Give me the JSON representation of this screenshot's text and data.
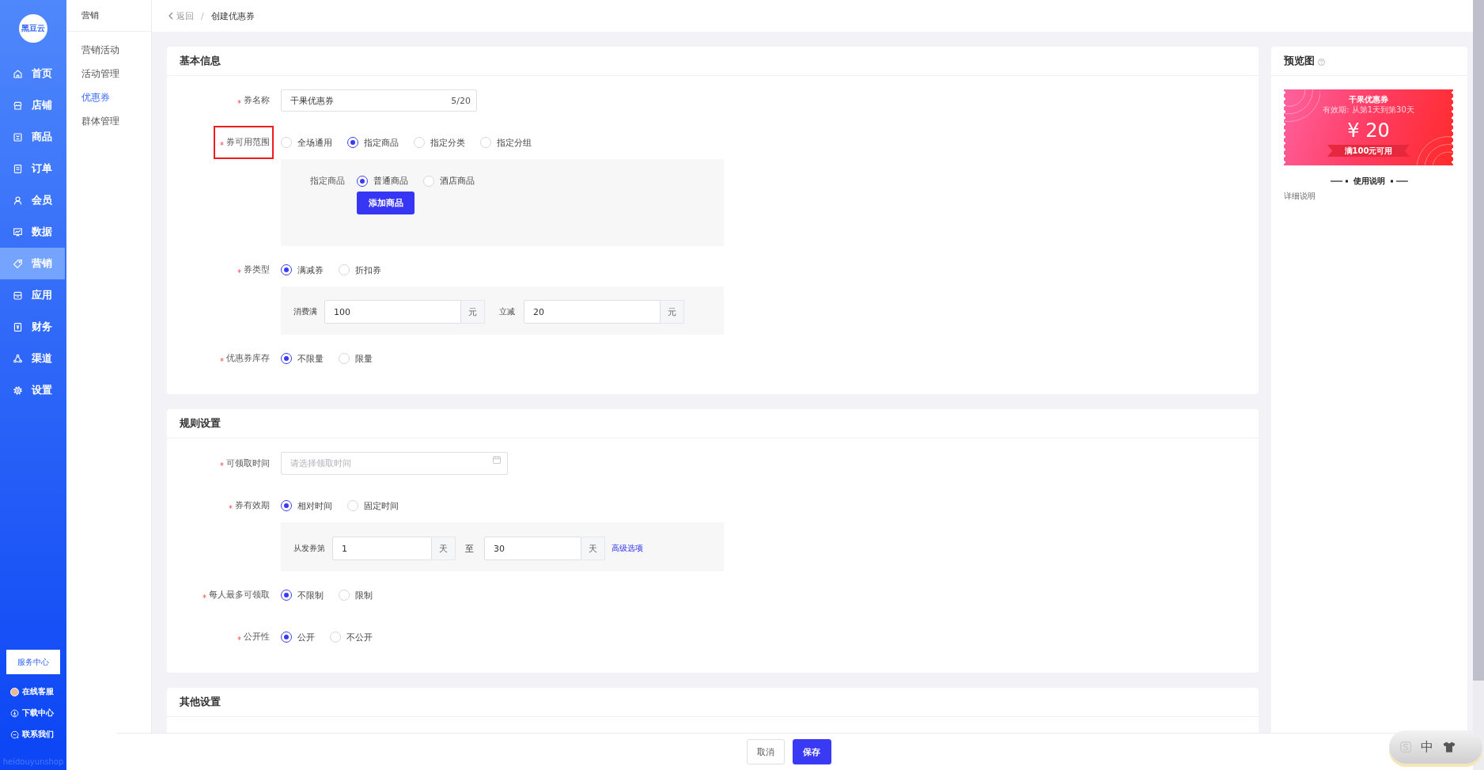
{
  "sidebar": {
    "logo": "黑豆云",
    "items": [
      {
        "label": "首页",
        "selected": false
      },
      {
        "label": "店铺",
        "selected": false
      },
      {
        "label": "商品",
        "selected": false
      },
      {
        "label": "订单",
        "selected": false
      },
      {
        "label": "会员",
        "selected": false
      },
      {
        "label": "数据",
        "selected": false
      },
      {
        "label": "营销",
        "selected": true
      },
      {
        "label": "应用",
        "selected": false
      },
      {
        "label": "财务",
        "selected": false
      },
      {
        "label": "渠道",
        "selected": false
      },
      {
        "label": "设置",
        "selected": false
      }
    ],
    "service_button": "服务中心",
    "links": [
      {
        "label": "在线客服"
      },
      {
        "label": "下载中心"
      },
      {
        "label": "联系我们"
      }
    ],
    "brand_text": "heidouyunshop"
  },
  "submenu": {
    "title": "营销",
    "items": [
      {
        "label": "营销活动",
        "selected": false
      },
      {
        "label": "活动管理",
        "selected": false
      },
      {
        "label": "优惠券",
        "selected": true
      },
      {
        "label": "群体管理",
        "selected": false
      }
    ]
  },
  "breadcrumb": {
    "back": "返回",
    "separator": "/",
    "current": "创建优惠券"
  },
  "sections": [
    {
      "title": "基本信息",
      "fields": [
        {
          "kind": "text",
          "label": "券名称",
          "required": true,
          "highlighted": false,
          "value": "干果优惠券",
          "counter": "5/20"
        },
        {
          "kind": "radio",
          "label": "券可用范围",
          "required": true,
          "highlighted": true,
          "options": [
            {
              "label": "全场通用",
              "selected": false
            },
            {
              "label": "指定商品",
              "selected": true
            },
            {
              "label": "指定分类",
              "selected": false
            },
            {
              "label": "指定分组",
              "selected": false
            }
          ],
          "panel": {
            "kind": "goods",
            "label": "指定商品",
            "options": [
              {
                "label": "普通商品",
                "selected": true
              },
              {
                "label": "酒店商品",
                "selected": false
              }
            ],
            "button": "添加商品"
          }
        },
        {
          "kind": "radio",
          "label": "券类型",
          "required": true,
          "highlighted": false,
          "options": [
            {
              "label": "满减券",
              "selected": true
            },
            {
              "label": "折扣券",
              "selected": false
            }
          ],
          "panel": {
            "kind": "amounts",
            "inputs": [
              {
                "label": "消费满",
                "value": "100",
                "unit": "元"
              },
              {
                "label": "立减",
                "value": "20",
                "unit": "元"
              }
            ]
          }
        },
        {
          "kind": "radio",
          "label": "优惠券库存",
          "required": true,
          "highlighted": false,
          "options": [
            {
              "label": "不限量",
              "selected": true
            },
            {
              "label": "限量",
              "selected": false
            }
          ]
        }
      ]
    },
    {
      "title": "规则设置",
      "fields": [
        {
          "kind": "date",
          "label": "可领取时间",
          "required": true,
          "highlighted": false,
          "placeholder": "请选择领取时间"
        },
        {
          "kind": "radio",
          "label": "券有效期",
          "required": true,
          "highlighted": false,
          "options": [
            {
              "label": "相对时间",
              "selected": true
            },
            {
              "label": "固定时间",
              "selected": false
            }
          ],
          "panel": {
            "kind": "range",
            "label": "从发券第",
            "from": {
              "value": "1",
              "unit": "天"
            },
            "separator": "至",
            "to": {
              "value": "30",
              "unit": "天"
            },
            "link": "高级选项"
          }
        },
        {
          "kind": "radio",
          "label": "每人最多可领取",
          "required": true,
          "highlighted": false,
          "options": [
            {
              "label": "不限制",
              "selected": true
            },
            {
              "label": "限制",
              "selected": false
            }
          ]
        },
        {
          "kind": "radio",
          "label": "公开性",
          "required": true,
          "highlighted": false,
          "options": [
            {
              "label": "公开",
              "selected": true
            },
            {
              "label": "不公开",
              "selected": false
            }
          ]
        }
      ]
    },
    {
      "title": "其他设置"
    }
  ],
  "preview": {
    "title": "预览图",
    "coupon": {
      "name": "干果优惠券",
      "validity": "有效期: 从第1天到第30天",
      "amount": "¥ 20",
      "condition": "满100元可用"
    },
    "usage_title": "使用说明",
    "usage_text": "详细说明"
  },
  "footer": {
    "buttons": [
      {
        "label": "取消",
        "kind": "default"
      },
      {
        "label": "保存",
        "kind": "primary"
      }
    ]
  },
  "ime_toolbar": {
    "mode": "中"
  }
}
